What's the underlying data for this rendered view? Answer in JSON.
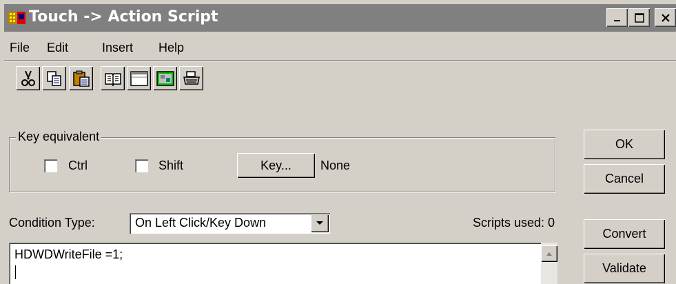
{
  "window": {
    "title": "Touch -> Action Script",
    "controls": [
      "minimize-icon",
      "maximize-icon",
      "close-icon"
    ]
  },
  "menu": [
    "File",
    "Edit",
    "Insert",
    "Help"
  ],
  "toolbar": [
    "cut-icon",
    "copy-icon",
    "paste-icon",
    "book-icon",
    "window-icon",
    "image-icon",
    "print-icon"
  ],
  "key_equivalent": {
    "legend": "Key equivalent",
    "ctrl_label": "Ctrl",
    "shift_label": "Shift",
    "key_button": "Key...",
    "key_value": "None"
  },
  "buttons": {
    "ok": "OK",
    "cancel": "Cancel",
    "convert": "Convert",
    "validate": "Validate"
  },
  "condition": {
    "label": "Condition Type:",
    "value": "On Left Click/Key Down"
  },
  "scripts_used": "Scripts used: 0",
  "editor": {
    "text": "HDWDWriteFile =1;"
  }
}
